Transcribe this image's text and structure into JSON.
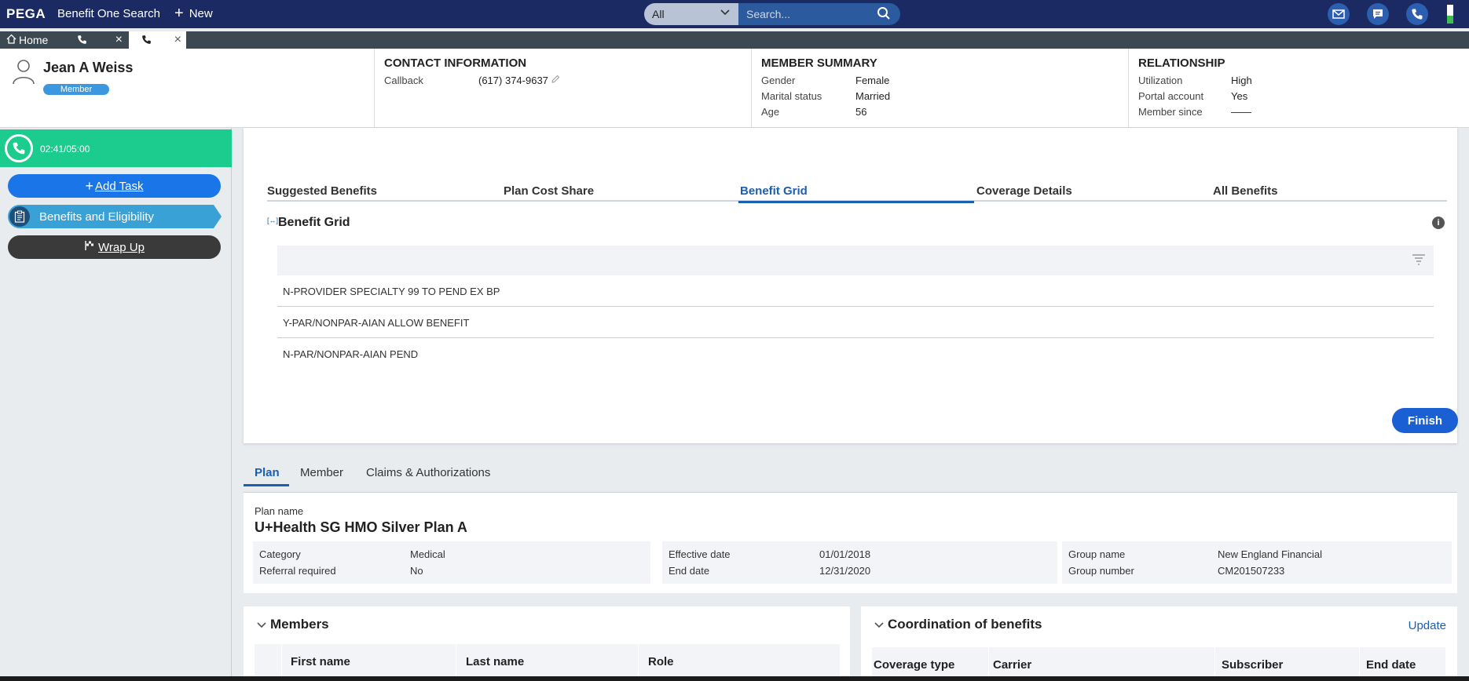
{
  "topbar": {
    "brand": "PEGA",
    "app_title": "Benefit One Search",
    "new_label": "New",
    "search_scope": "All",
    "search_placeholder": "Search..."
  },
  "tabs": {
    "home_label": "Home"
  },
  "member": {
    "name": "Jean A Weiss",
    "badge": "Member"
  },
  "contact": {
    "title": "CONTACT INFORMATION",
    "callback_label": "Callback",
    "callback_value": "(617) 374-9637"
  },
  "summary": {
    "title": "MEMBER SUMMARY",
    "gender_label": "Gender",
    "gender_value": "Female",
    "marital_label": "Marital status",
    "marital_value": "Married",
    "age_label": "Age",
    "age_value": "56"
  },
  "relationship": {
    "title": "RELATIONSHIP",
    "utilization_label": "Utilization",
    "utilization_value": "High",
    "portal_label": "Portal account",
    "portal_value": "Yes",
    "since_label": "Member since",
    "since_value": "——"
  },
  "leftpanel": {
    "timer": "02:41/05:00",
    "add_task": "Add Task",
    "benefits": "Benefits and Eligibility",
    "wrap_up": "Wrap Up"
  },
  "main": {
    "tabs": [
      {
        "label": "Suggested Benefits"
      },
      {
        "label": "Plan Cost Share"
      },
      {
        "label": "Benefit Grid"
      },
      {
        "label": "Coverage Details"
      },
      {
        "label": "All Benefits"
      }
    ],
    "grid_title": "Benefit Grid",
    "rows": [
      "N-PROVIDER SPECIALTY 99 TO PEND EX BP",
      "Y-PAR/NONPAR-AIAN ALLOW BENEFIT",
      "N-PAR/NONPAR-AIAN PEND"
    ],
    "finish": "Finish"
  },
  "lower_tabs": {
    "plan": "Plan",
    "member": "Member",
    "claims": "Claims & Authorizations"
  },
  "plan": {
    "name_label": "Plan name",
    "name_value": "U+Health SG HMO Silver Plan A",
    "category_label": "Category",
    "category_value": "Medical",
    "referral_label": "Referral required",
    "referral_value": "No",
    "effective_label": "Effective date",
    "effective_value": "01/01/2018",
    "end_label": "End date",
    "end_value": "12/31/2020",
    "group_name_label": "Group name",
    "group_name_value": "New England Financial",
    "group_number_label": "Group number",
    "group_number_value": "CM201507233"
  },
  "members_section": {
    "title": "Members",
    "cols": [
      "First name",
      "Last name",
      "Role"
    ]
  },
  "cob_section": {
    "title": "Coordination of benefits",
    "update": "Update",
    "cols": [
      "Coverage type",
      "Carrier",
      "Subscriber",
      "End date"
    ]
  },
  "colors": {
    "topbar": "#1b2a62",
    "accent": "#1a5fb0",
    "timer": "#1bcc8e"
  }
}
